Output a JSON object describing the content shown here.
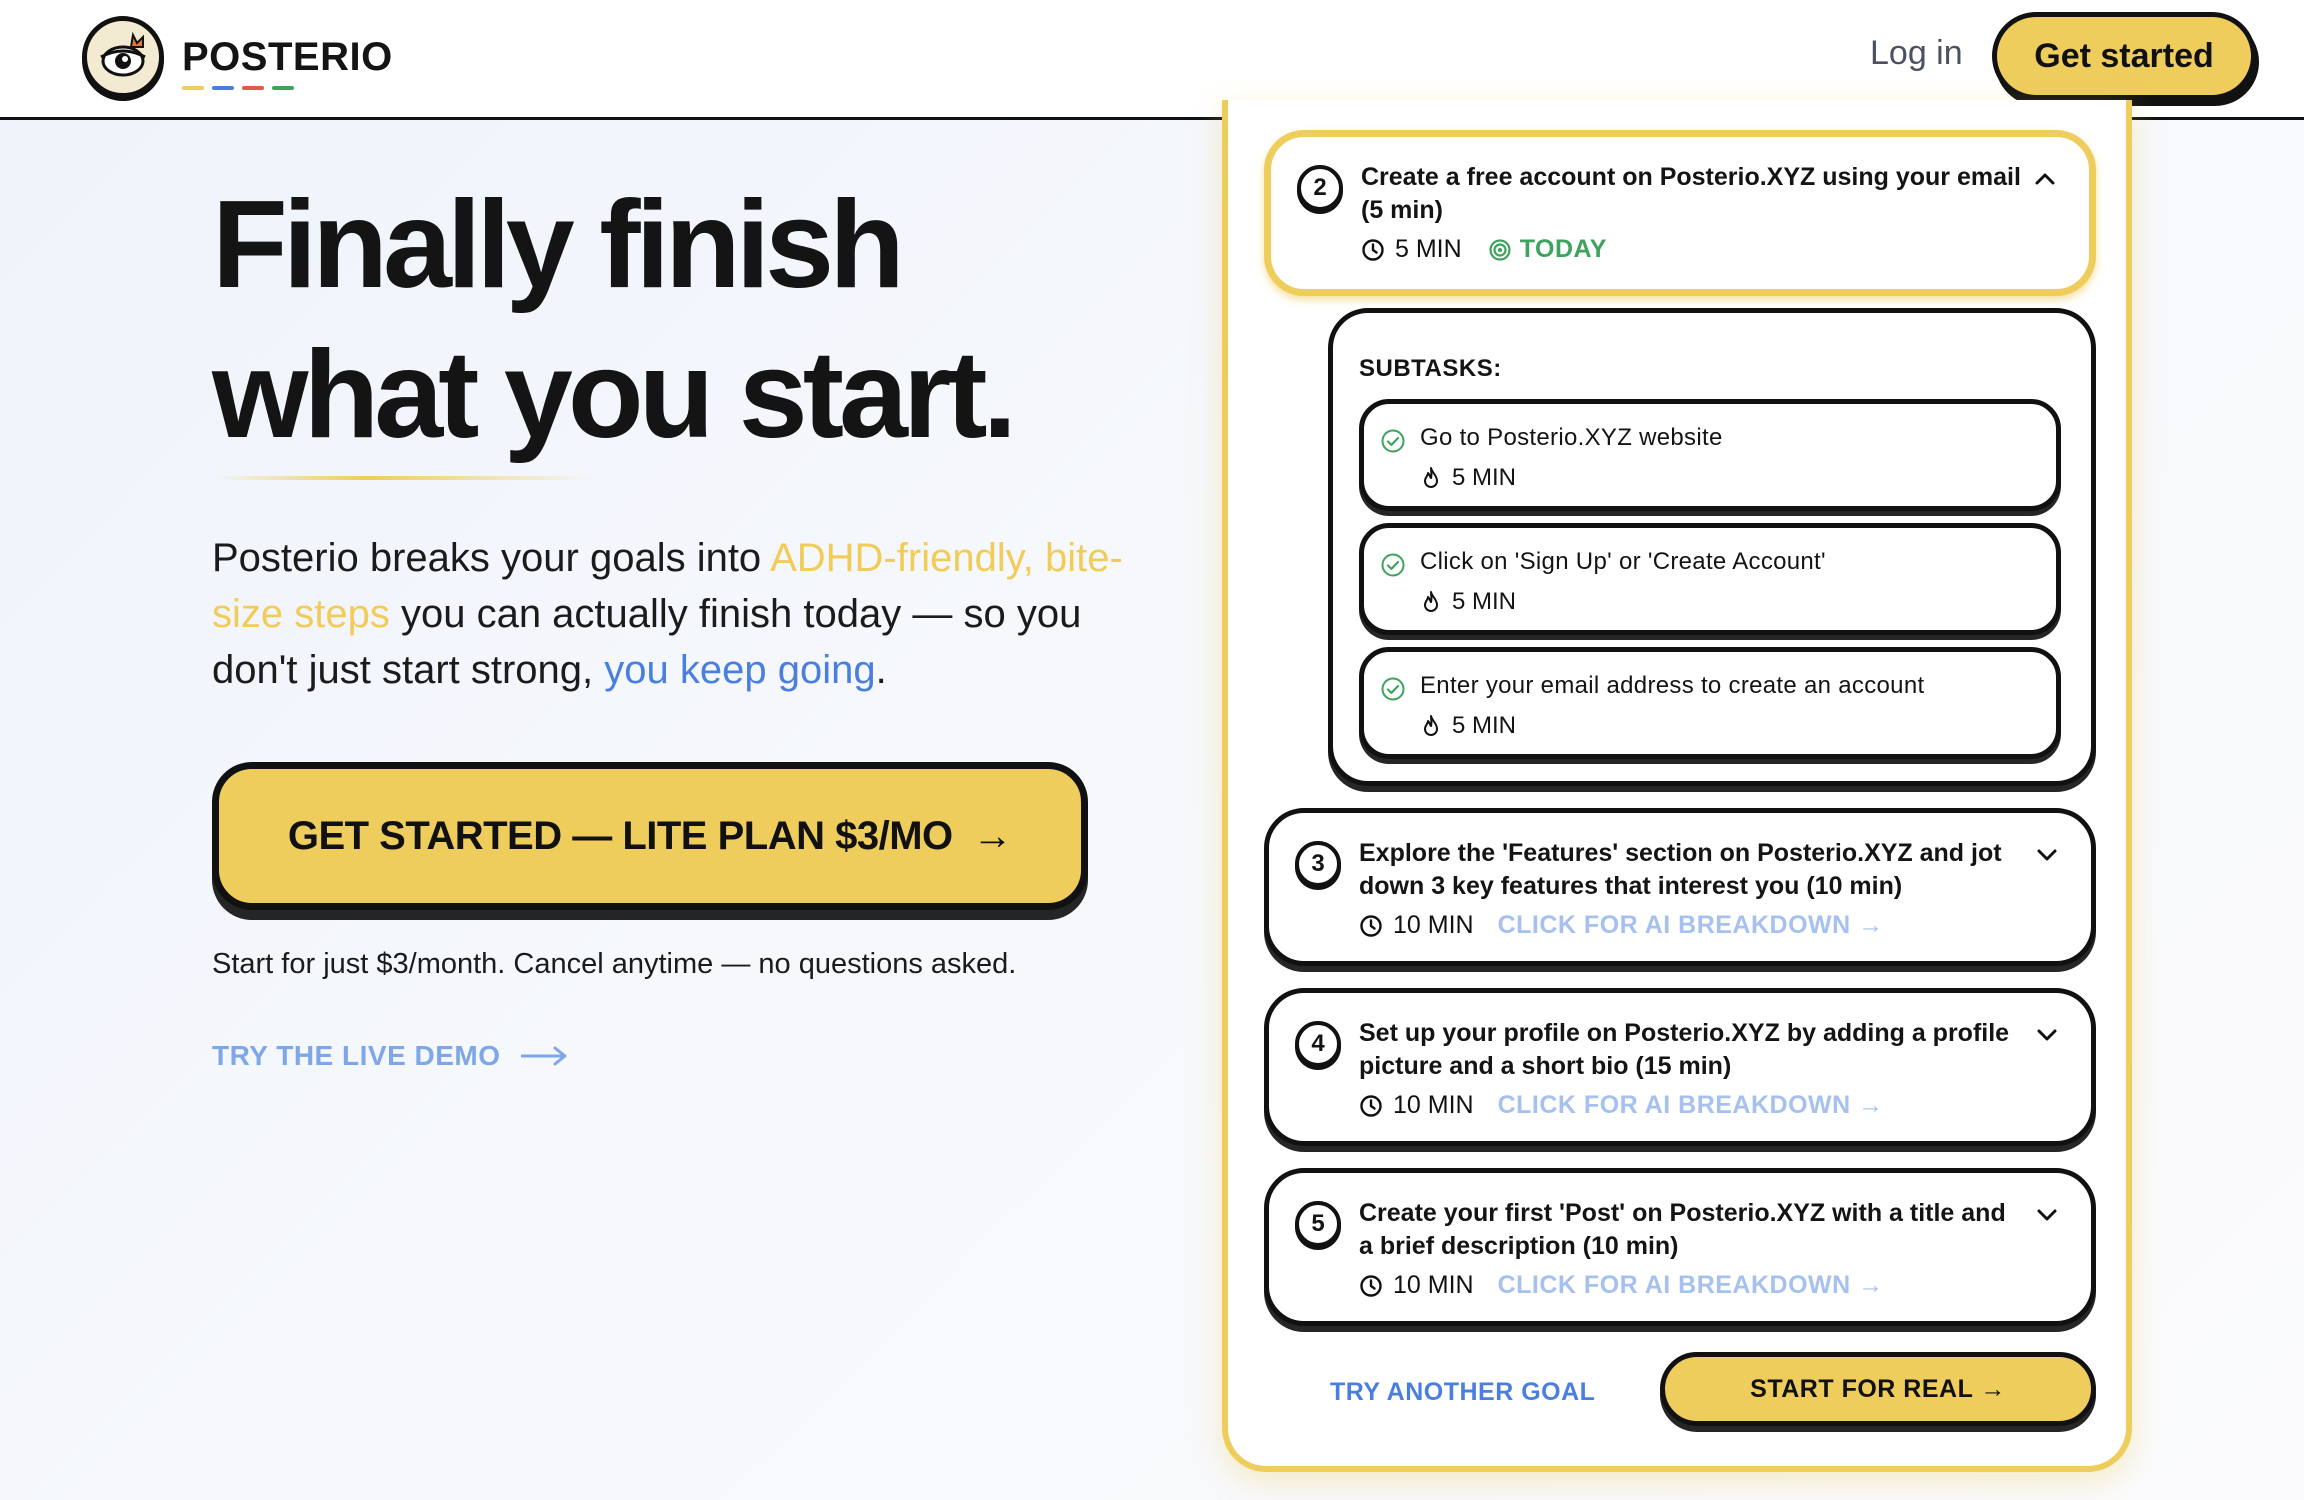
{
  "brand": {
    "name": "POSTERIO",
    "underline_colors": [
      "#efcd5c",
      "#4a7fe0",
      "#e05a4a",
      "#3ea35c"
    ]
  },
  "nav": {
    "login": "Log in",
    "cta": "Get started"
  },
  "hero": {
    "title_line1": "Finally finish",
    "title_line2": "what you start.",
    "sub_part1": "Posterio breaks your goals into ",
    "sub_highlight1": "ADHD-friendly, bite-size steps",
    "sub_part2": " you can actually finish today — so you don't just start strong, ",
    "sub_highlight2": "you keep going",
    "sub_part3": ".",
    "cta": "GET STARTED — LITE PLAN $3/MO",
    "note": "Start for just $3/month. Cancel anytime — no questions asked.",
    "demo_link": "TRY THE LIVE DEMO"
  },
  "demo": {
    "active_task": {
      "number": "2",
      "title": "Create a free account on Posterio.XYZ using your email (5 min)",
      "time": "5 MIN",
      "badge": "TODAY"
    },
    "subtasks_label": "SUBTASKS:",
    "subtasks": [
      {
        "text": "Go to Posterio.XYZ website",
        "time": "5 MIN"
      },
      {
        "text": "Click on 'Sign Up' or 'Create Account'",
        "time": "5 MIN"
      },
      {
        "text": "Enter your email address to create an account",
        "time": "5 MIN"
      }
    ],
    "tasks": [
      {
        "number": "3",
        "title": "Explore the 'Features' section on Posterio.XYZ and jot down 3 key features that interest you (10 min)",
        "time": "10 MIN",
        "ai": "CLICK FOR AI BREAKDOWN →"
      },
      {
        "number": "4",
        "title": "Set up your profile on Posterio.XYZ by adding a profile picture and a short bio (15 min)",
        "time": "10 MIN",
        "ai": "CLICK FOR AI BREAKDOWN →"
      },
      {
        "number": "5",
        "title": "Create your first 'Post' on Posterio.XYZ with a title and a brief description (10 min)",
        "time": "10 MIN",
        "ai": "CLICK FOR AI BREAKDOWN →"
      }
    ],
    "try_another": "TRY ANOTHER GOAL",
    "start_real": "START FOR REAL →"
  },
  "colors": {
    "accent_yellow": "#efcd5c",
    "accent_blue": "#4a7fe0",
    "success_green": "#3ea35c",
    "ink": "#111111"
  },
  "icons": [
    "logo-icon",
    "clock-icon",
    "target-icon",
    "chevron-up-icon",
    "chevron-down-icon",
    "check-circle-icon",
    "flame-icon",
    "arrow-right-icon"
  ]
}
